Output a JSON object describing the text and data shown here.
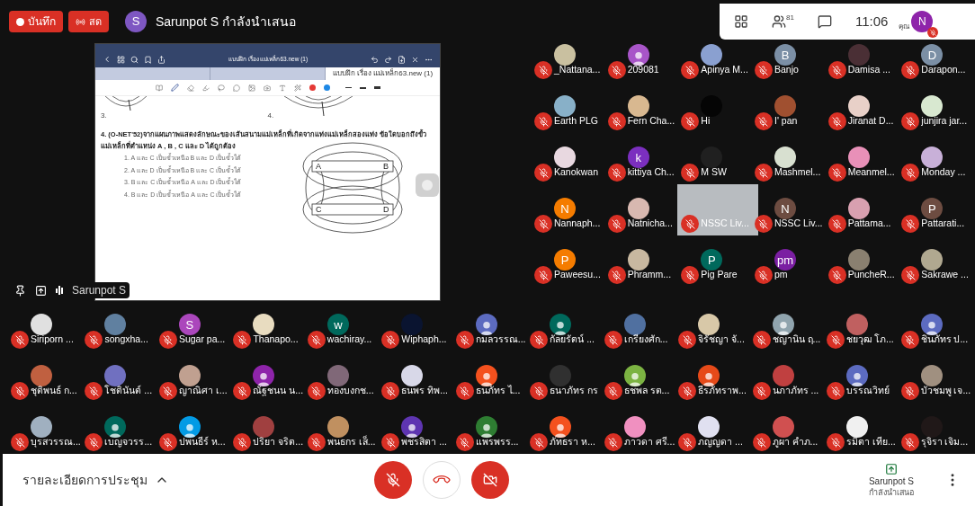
{
  "top_bar": {
    "record_label": "บันทึก",
    "live_label": "สด",
    "presenter_initial": "S",
    "presenter_text": "Sarunpot S กำลังนำเสนอ",
    "participant_count": "81",
    "time": "11:06",
    "self_label": "คุณ",
    "self_initial": "N"
  },
  "presentation": {
    "doc_title": "แบบฝึก เรื่อง แม่เหล็ก63.new (1)",
    "tabs": [
      {
        "selected": false
      },
      {
        "selected": false
      },
      {
        "label": "แบบฝึก เรื่อง แม่เหล็ก63.new (1)",
        "selected": true
      }
    ],
    "pen_colors": [
      {
        "color": "#e53935"
      },
      {
        "color": "#1e88e5"
      }
    ],
    "figure_labels": [
      "3.",
      "4."
    ],
    "question": "4. (O-NET'52)จากแผนภาพแสดงลักษณะของเส้นสนามแม่เหล็กที่เกิดจากแท่งแม่เหล็กสองแท่ง  ข้อใดบอกถึงขั้วแม่เหล็กที่ตำแหน่ง A , B , C และ D ได้ถูกต้อง",
    "options": [
      "1.   A และ C เป็นขั้วเหนือ B และ D เป็นขั้วใต้",
      "2.   A และ D เป็นขั้วเหนือ B และ C เป็นขั้วใต้",
      "3.   B และ C เป็นขั้วเหนือ A และ D เป็นขั้วใต้",
      "4.   B และ D เป็นขั้วเหนือ A และ C เป็นขั้วใต้"
    ],
    "magnet_labels": [
      "A",
      "B",
      "C",
      "D"
    ],
    "presenter_name": "Sarunpot S"
  },
  "grid": [
    {
      "name": "_Nattana...",
      "kind": "photo",
      "color": "#c9c0a0"
    },
    {
      "name": "209081",
      "kind": "person",
      "color": "#a855c8"
    },
    {
      "name": "Apinya M...",
      "kind": "photo",
      "color": "#8aa0d0"
    },
    {
      "name": "Banjo",
      "kind": "letter",
      "letter": "B",
      "color": "#7b8fa5"
    },
    {
      "name": "Damisa ...",
      "kind": "photo",
      "color": "#4a2f35"
    },
    {
      "name": "Darapon...",
      "kind": "letter",
      "letter": "D",
      "color": "#7b8fa5"
    },
    {
      "name": "Earth PLG",
      "kind": "photo",
      "color": "#88b0c8"
    },
    {
      "name": "Fern Cha...",
      "kind": "photo",
      "color": "#d8b890"
    },
    {
      "name": "Hi",
      "kind": "photo",
      "color": "#050505"
    },
    {
      "name": "I' pan",
      "kind": "photo",
      "color": "#a05030"
    },
    {
      "name": "Jiranat D...",
      "kind": "photo",
      "color": "#e8d0c8"
    },
    {
      "name": "junjira jar...",
      "kind": "photo",
      "color": "#d8e8d0"
    },
    {
      "name": "Kanokwan",
      "kind": "photo",
      "color": "#e8d8e0"
    },
    {
      "name": "kittiya Ch...",
      "kind": "letter",
      "letter": "k",
      "color": "#7b2fbf"
    },
    {
      "name": "M SW",
      "kind": "photo",
      "color": "#202020"
    },
    {
      "name": "Mashmel...",
      "kind": "photo",
      "color": "#d8e0d0"
    },
    {
      "name": "Meanmel...",
      "kind": "photo",
      "color": "#e890b8"
    },
    {
      "name": "Monday ...",
      "kind": "photo",
      "color": "#c8b0d8"
    },
    {
      "name": "Nannaph...",
      "kind": "letter",
      "letter": "N",
      "color": "#f57c00"
    },
    {
      "name": "Natnicha...",
      "kind": "photo",
      "color": "#d8b8b0"
    },
    {
      "name": "NSSC Liv...",
      "kind": "video",
      "color": "#b8bcc0"
    },
    {
      "name": "NSSC Liv...",
      "kind": "letter",
      "letter": "N",
      "color": "#6d4c41"
    },
    {
      "name": "Pattama...",
      "kind": "photo",
      "color": "#d8a0b0"
    },
    {
      "name": "Pattarati...",
      "kind": "letter",
      "letter": "P",
      "color": "#6d4c41"
    },
    {
      "name": "Paweesu...",
      "kind": "letter",
      "letter": "P",
      "color": "#f57c00"
    },
    {
      "name": "Phramm...",
      "kind": "photo",
      "color": "#c8b8a0"
    },
    {
      "name": "Pig Pare",
      "kind": "letter",
      "letter": "P",
      "color": "#00695c"
    },
    {
      "name": "pm",
      "kind": "letter",
      "letter": "pm",
      "color": "#7b1fa2"
    },
    {
      "name": "PuncheR...",
      "kind": "photo",
      "color": "#8a8070"
    },
    {
      "name": "Sakrawe ...",
      "kind": "photo",
      "color": "#b0a890"
    }
  ],
  "rows": [
    {
      "name": "Siriporn ...",
      "kind": "photo",
      "color": "#e0e0e0"
    },
    {
      "name": "songxha...",
      "kind": "photo",
      "color": "#6080a0"
    },
    {
      "name": "Sugar pa...",
      "kind": "letter",
      "letter": "S",
      "color": "#ab47bc"
    },
    {
      "name": "Thanapo...",
      "kind": "photo",
      "color": "#e8dcc0"
    },
    {
      "name": "wachiray...",
      "kind": "letter",
      "letter": "w",
      "color": "#00695c"
    },
    {
      "name": "Wiphaph...",
      "kind": "photo",
      "color": "#0a1430"
    },
    {
      "name": "กมลวรรณ...",
      "kind": "person",
      "color": "#5c6bc0"
    },
    {
      "name": "กัลยรัตน์ ...",
      "kind": "person",
      "color": "#00695c"
    },
    {
      "name": "เกรียงศัก...",
      "kind": "photo",
      "color": "#5070a0"
    },
    {
      "name": "จิรัชญา จั...",
      "kind": "photo",
      "color": "#d8c8a8"
    },
    {
      "name": "ชญานิน ฤ...",
      "kind": "person",
      "color": "#90a4ae"
    },
    {
      "name": "ชยวุฒ โภ...",
      "kind": "photo",
      "color": "#c06060"
    },
    {
      "name": "ชินภัทร ป...",
      "kind": "person",
      "color": "#5c6bc0"
    },
    {
      "name": "ชุติพนธ์ ก...",
      "kind": "photo",
      "color": "#c06040"
    },
    {
      "name": "โชตินันต์ ...",
      "kind": "photo",
      "color": "#7070c0"
    },
    {
      "name": "ญาณิศา เ...",
      "kind": "photo",
      "color": "#c0a090"
    },
    {
      "name": "ณัฐชนน น...",
      "kind": "person",
      "color": "#8e24aa"
    },
    {
      "name": "ทองบงกช...",
      "kind": "photo",
      "color": "#806878"
    },
    {
      "name": "ธนพร ทิพ...",
      "kind": "photo",
      "color": "#d8d8e8"
    },
    {
      "name": "ธนภัทร ไ...",
      "kind": "person",
      "color": "#f4511e"
    },
    {
      "name": "ธนาภัทร กร",
      "kind": "photo",
      "color": "#303030"
    },
    {
      "name": "ธชพล รต...",
      "kind": "person",
      "color": "#7cb342"
    },
    {
      "name": "ธีรภัทราพ...",
      "kind": "person",
      "color": "#e64a19"
    },
    {
      "name": "นภาภัทร ...",
      "kind": "photo",
      "color": "#c04040"
    },
    {
      "name": "บรรณวิทย์",
      "kind": "person",
      "color": "#5c6bc0"
    },
    {
      "name": "บัวชมพู เจ...",
      "kind": "photo",
      "color": "#a09080"
    },
    {
      "name": "บุรสวรรณ...",
      "kind": "photo",
      "color": "#a0b0c0"
    },
    {
      "name": "เบญจวรร...",
      "kind": "person",
      "color": "#00695c"
    },
    {
      "name": "ปพนธีร์ ห...",
      "kind": "person",
      "color": "#039be5"
    },
    {
      "name": "ปริยา จริต...",
      "kind": "photo",
      "color": "#a04040"
    },
    {
      "name": "พนธกร เส็...",
      "kind": "photo",
      "color": "#c09060"
    },
    {
      "name": "พชรสิตา ...",
      "kind": "person",
      "color": "#5e35b1"
    },
    {
      "name": "แพรพรร...",
      "kind": "person",
      "color": "#2e7d32"
    },
    {
      "name": "ภัทธรา ห...",
      "kind": "person",
      "color": "#f4511e"
    },
    {
      "name": "ภาวดา ศรี...",
      "kind": "photo",
      "color": "#f090c0"
    },
    {
      "name": "ภญญดา ...",
      "kind": "photo",
      "color": "#e0e0f0"
    },
    {
      "name": "ภูผา คำภ...",
      "kind": "photo",
      "color": "#d05050"
    },
    {
      "name": "รมิตา เทีย...",
      "kind": "photo",
      "color": "#f0f0f0"
    },
    {
      "name": "รุจิรา เจิม...",
      "kind": "photo",
      "color": "#201818"
    }
  ],
  "bottom_bar": {
    "details": "รายละเอียดการประชุม",
    "presenter_name": "Sarunpot S",
    "presenter_status": "กำลังนำเสนอ"
  }
}
